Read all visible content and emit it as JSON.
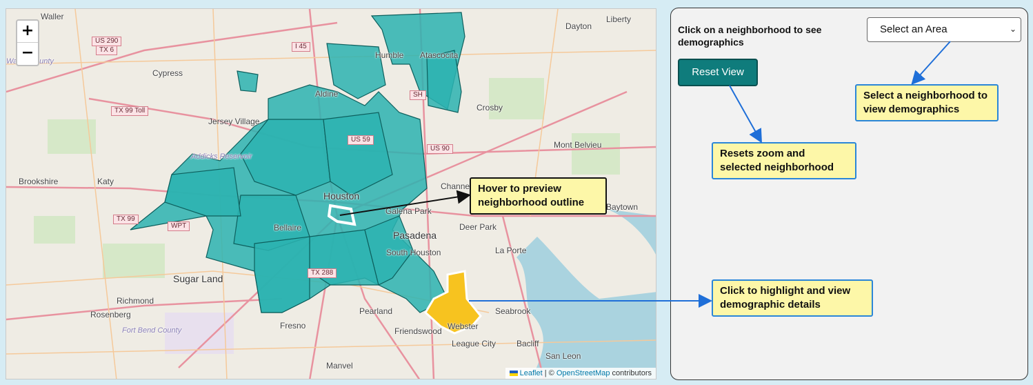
{
  "map": {
    "zoom_in": "+",
    "zoom_out": "−",
    "places": [
      "Waller",
      "Cypress",
      "Jersey Village",
      "Katy",
      "Brookshire",
      "Houston",
      "Bellaire",
      "Pasadena",
      "South Houston",
      "Sugar Land",
      "Richmond",
      "Rosenberg",
      "Fresno",
      "Pearland",
      "Friendswood",
      "Webster",
      "League City",
      "Seabrook",
      "Bacliff",
      "San Leon",
      "Manvel",
      "Humble",
      "Atascocita",
      "Aldine",
      "Crosby",
      "Mont Belvieu",
      "Channelview",
      "Deer Park",
      "La Porte",
      "Dayton",
      "Liberty",
      "Galena Park",
      "Baytown"
    ],
    "county_labels": [
      "Fort Bend County",
      "Waller County",
      "Addicks Reservoir"
    ],
    "shields": [
      "US 290",
      "TX 6",
      "I 45",
      "TX 99 Toll",
      "US 90",
      "TX 99",
      "WPT",
      "TX 288",
      "SH",
      "US 59"
    ],
    "attribution": {
      "leaflet": "Leaflet",
      "sep": " | © ",
      "osm": "OpenStreetMap",
      "rest": " contributors"
    }
  },
  "panel": {
    "instruction": "Click on a neighborhood to see demographics",
    "select": {
      "value": "Select an Area",
      "options": [
        "Select an Area"
      ]
    },
    "reset_label": "Reset View"
  },
  "callouts": {
    "select": "Select a neighborhood to view demographics",
    "reset": "Resets zoom and selected neighborhood",
    "hover": "Hover to preview neighborhood outline",
    "click": "Click to highlight and view demographic details"
  },
  "colors": {
    "neighborhood_fill": "#2bb3b0",
    "neighborhood_stroke": "#0d5f5d",
    "highlight_fill": "#f7c31f",
    "callout_bg": "#fdf7a8",
    "callout_border": "#2a86d8",
    "reset_button": "#0f7c7c"
  }
}
